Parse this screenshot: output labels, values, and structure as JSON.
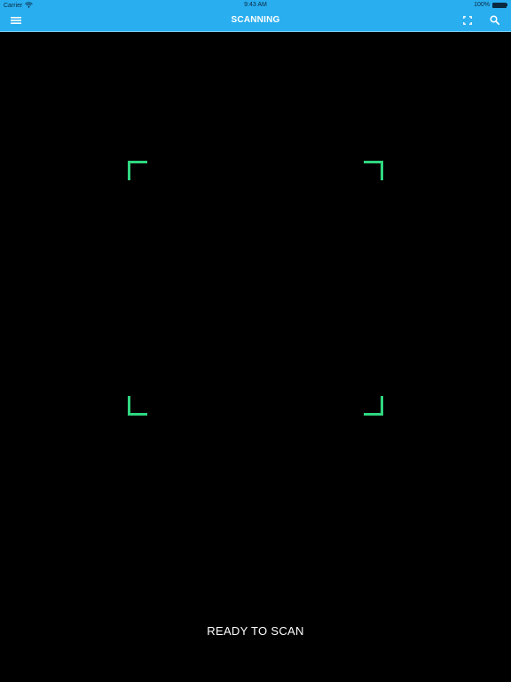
{
  "status_bar": {
    "carrier": "Carrier",
    "time": "9:43 AM",
    "battery": "100%"
  },
  "nav": {
    "title": "SCANNING",
    "menu_icon": "hamburger-menu-icon",
    "fullscreen_icon": "fullscreen-icon",
    "search_icon": "search-icon"
  },
  "scanner": {
    "status": "READY TO SCAN",
    "frame_color": "#2fd680"
  },
  "colors": {
    "nav_background": "#29aef0",
    "screen_background": "#000000"
  }
}
